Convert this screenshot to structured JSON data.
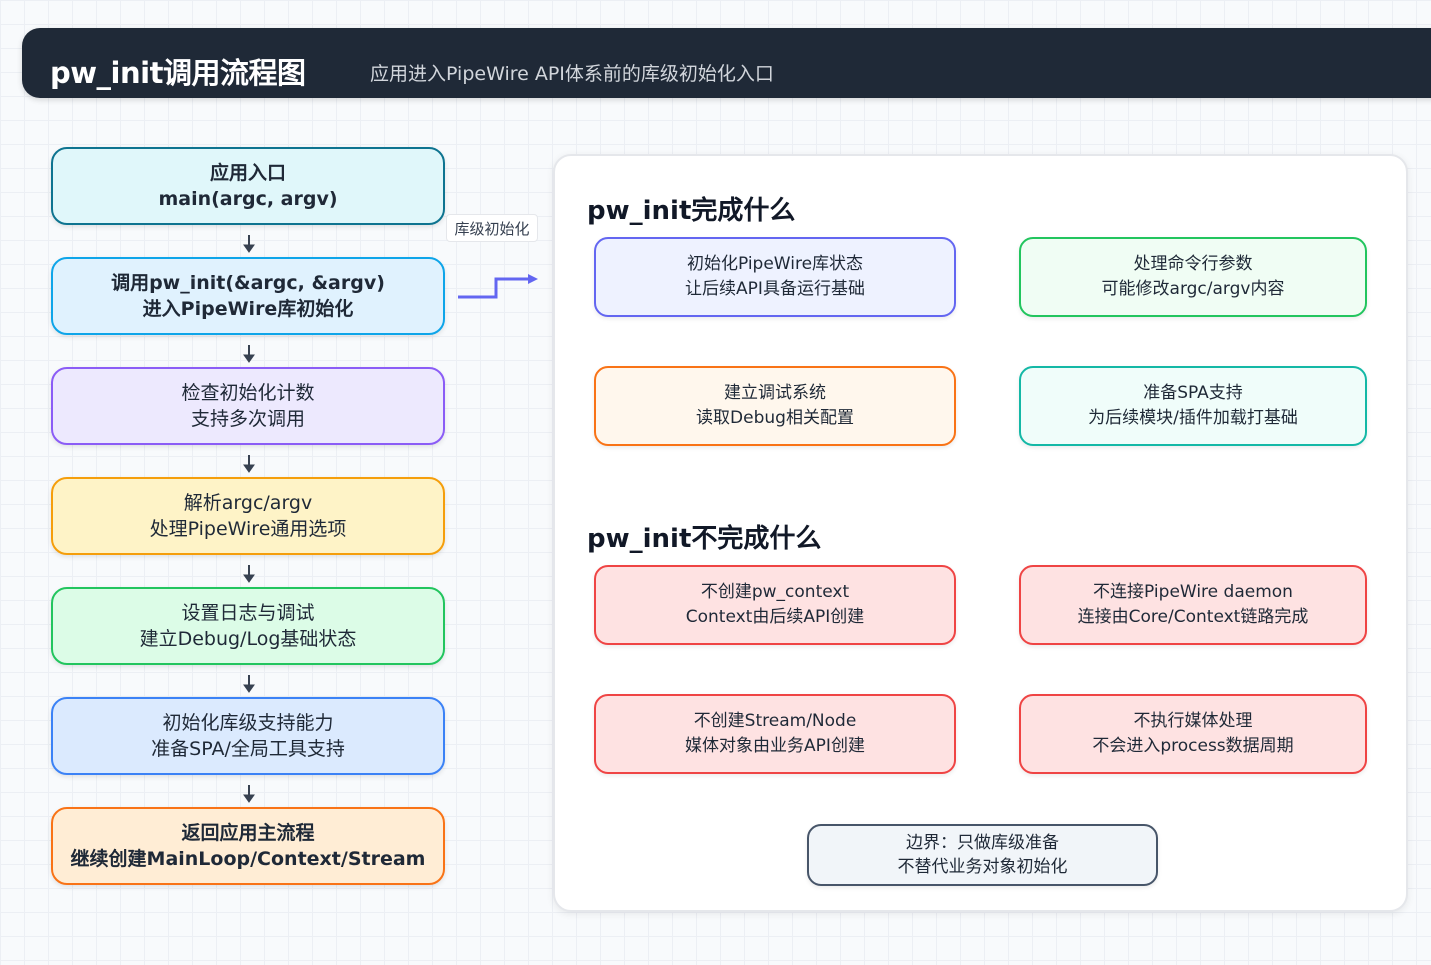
{
  "header": {
    "title": "pw_init调用流程图",
    "subtitle": "应用进入PipeWire API体系前的库级初始化入口"
  },
  "flow": {
    "steps": [
      {
        "line1": "应用入口",
        "line2": "main(argc, argv)",
        "border": "#0e7490",
        "fill": "#e0f7fa"
      },
      {
        "line1": "调用pw_init(&argc, &argv)",
        "line2": "进入PipeWire库初始化",
        "border": "#0ea5e9",
        "fill": "#e0f2fe"
      },
      {
        "line1": "检查初始化计数",
        "line2": "支持多次调用",
        "border": "#8b5cf6",
        "fill": "#ede9fe"
      },
      {
        "line1": "解析argc/argv",
        "line2": "处理PipeWire通用选项",
        "border": "#f59e0b",
        "fill": "#fef3c7"
      },
      {
        "line1": "设置日志与调试",
        "line2": "建立Debug/Log基础状态",
        "border": "#22c55e",
        "fill": "#dcfce7"
      },
      {
        "line1": "初始化库级支持能力",
        "line2": "准备SPA/全局工具支持",
        "border": "#3b82f6",
        "fill": "#dbeafe"
      },
      {
        "line1": "返回应用主流程",
        "line2": "继续创建MainLoop/Context/Stream",
        "border": "#f97316",
        "fill": "#ffedd5"
      }
    ],
    "side_label": "库级初始化",
    "arrow_color": "#374151",
    "connector_color": "#6366f1"
  },
  "panel": {
    "does_title": "pw_init完成什么",
    "does": [
      {
        "line1": "初始化PipeWire库状态",
        "line2": "让后续API具备运行基础",
        "border": "#6366f1",
        "fill": "#eef2ff"
      },
      {
        "line1": "处理命令行参数",
        "line2": "可能修改argc/argv内容",
        "border": "#22c55e",
        "fill": "#f0fdf4"
      },
      {
        "line1": "建立调试系统",
        "line2": "读取Debug相关配置",
        "border": "#f97316",
        "fill": "#fff7ed"
      },
      {
        "line1": "准备SPA支持",
        "line2": "为后续模块/插件加载打基础",
        "border": "#14b8a6",
        "fill": "#f0fdfa"
      }
    ],
    "doesnt_title": "pw_init不完成什么",
    "doesnt": [
      {
        "line1": "不创建pw_context",
        "line2": "Context由后续API创建",
        "border": "#ef4444",
        "fill": "#fee2e2"
      },
      {
        "line1": "不连接PipeWire daemon",
        "line2": "连接由Core/Context链路完成",
        "border": "#ef4444",
        "fill": "#fee2e2"
      },
      {
        "line1": "不创建Stream/Node",
        "line2": "媒体对象由业务API创建",
        "border": "#ef4444",
        "fill": "#fee2e2"
      },
      {
        "line1": "不执行媒体处理",
        "line2": "不会进入process数据周期",
        "border": "#ef4444",
        "fill": "#fee2e2"
      }
    ],
    "boundary": {
      "line1": "边界：只做库级准备",
      "line2": "不替代业务对象初始化",
      "border": "#475569",
      "fill": "#f1f5f9"
    }
  }
}
